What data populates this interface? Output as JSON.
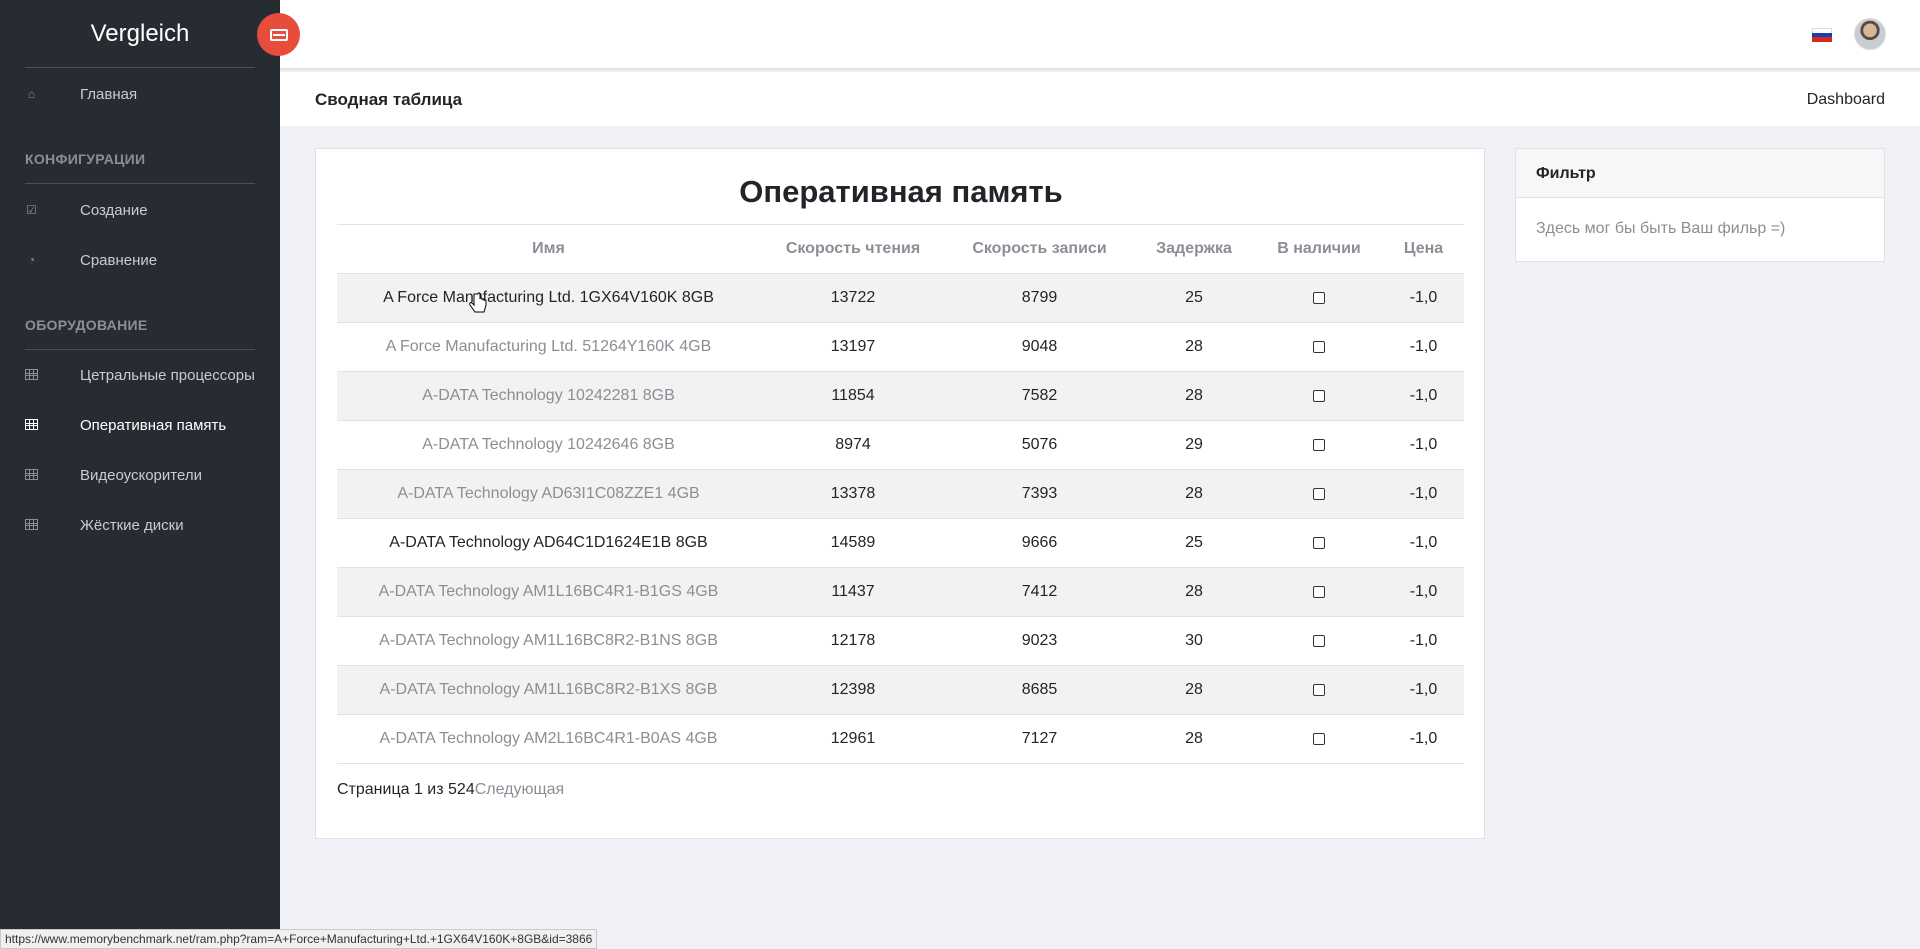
{
  "brand": "Vergleich",
  "sidebar": {
    "home": "Главная",
    "section_config": "КОНФИГУРАЦИИ",
    "create": "Создание",
    "compare": "Сравнение",
    "section_hardware": "ОБОРУДОВАНИЕ",
    "cpu": "Цетральные процессоры",
    "ram": "Оперативная память",
    "gpu": "Видеоускорители",
    "hdd": "Жёсткие диски"
  },
  "header": {
    "page_title": "Сводная таблица",
    "breadcrumb": "Dashboard"
  },
  "table": {
    "title": "Оперативная память",
    "columns": [
      "Имя",
      "Скорость чтения",
      "Скорость записи",
      "Задержка",
      "В наличии",
      "Цена"
    ],
    "rows": [
      {
        "name": "A Force Manufacturing Ltd. 1GX64V160K 8GB",
        "read": "13722",
        "write": "8799",
        "latency": "25",
        "price": "-1,0"
      },
      {
        "name": "A Force Manufacturing Ltd. 51264Y160K 4GB",
        "read": "13197",
        "write": "9048",
        "latency": "28",
        "price": "-1,0"
      },
      {
        "name": "A-DATA Technology 10242281 8GB",
        "read": "11854",
        "write": "7582",
        "latency": "28",
        "price": "-1,0"
      },
      {
        "name": "A-DATA Technology 10242646 8GB",
        "read": "8974",
        "write": "5076",
        "latency": "29",
        "price": "-1,0"
      },
      {
        "name": "A-DATA Technology AD63I1C08ZZE1 4GB",
        "read": "13378",
        "write": "7393",
        "latency": "28",
        "price": "-1,0"
      },
      {
        "name": "A-DATA Technology AD64C1D1624E1B 8GB",
        "read": "14589",
        "write": "9666",
        "latency": "25",
        "price": "-1,0"
      },
      {
        "name": "A-DATA Technology AM1L16BC4R1-B1GS 4GB",
        "read": "11437",
        "write": "7412",
        "latency": "28",
        "price": "-1,0"
      },
      {
        "name": "A-DATA Technology AM1L16BC8R2-B1NS 8GB",
        "read": "12178",
        "write": "9023",
        "latency": "30",
        "price": "-1,0"
      },
      {
        "name": "A-DATA Technology AM1L16BC8R2-B1XS 8GB",
        "read": "12398",
        "write": "8685",
        "latency": "28",
        "price": "-1,0"
      },
      {
        "name": "A-DATA Technology AM2L16BC4R1-B0AS 4GB",
        "read": "12961",
        "write": "7127",
        "latency": "28",
        "price": "-1,0"
      }
    ],
    "pager_text": "Страница 1 из 524",
    "pager_next": "Следующая"
  },
  "filter": {
    "title": "Фильтр",
    "body": "Здесь мог бы быть Ваш фильр =)"
  },
  "status_url": "https://www.memorybenchmark.net/ram.php?ram=A+Force+Manufacturing+Ltd.+1GX64V160K+8GB&id=3866",
  "colors": {
    "sidebar": "#272c33",
    "accent": "#e74c3c",
    "background": "#f1f2f7"
  }
}
